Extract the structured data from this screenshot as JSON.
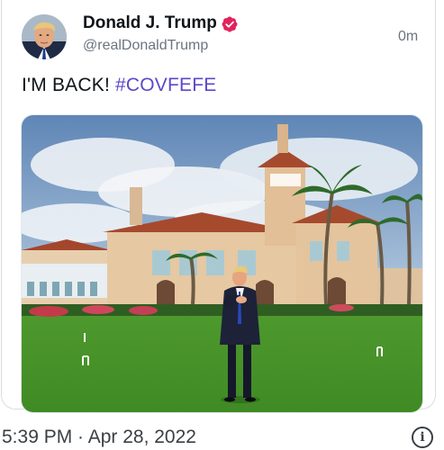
{
  "tweet": {
    "author": {
      "display_name": "Donald J. Trump",
      "handle": "@realDonaldTrump",
      "verified": true,
      "verified_badge_color": "#e0245e",
      "avatar_icon": "avatar-photo"
    },
    "time_ago": "0m",
    "text_prefix": "I'M BACK! ",
    "hashtag": "#COVFEFE",
    "hashtag_color": "#5b49c8",
    "media": {
      "kind": "photo",
      "subject": "man in dark suit on lawn in front of mansion"
    }
  },
  "footer": {
    "timestamp": "5:39 PM · Apr 28, 2022",
    "info_icon": "info-icon"
  }
}
